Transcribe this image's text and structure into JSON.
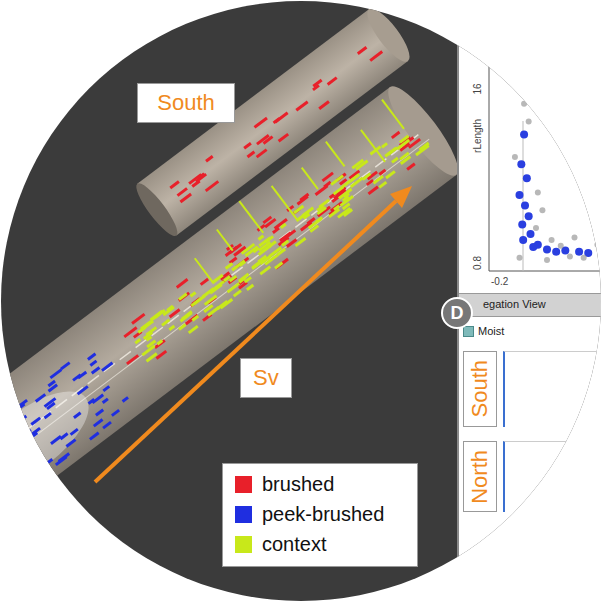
{
  "view3d": {
    "tunnel_label": "South",
    "axis_label": "Sv"
  },
  "legend": [
    {
      "label": "brushed",
      "color": "#e8202a"
    },
    {
      "label": "peek-brushed",
      "color": "#1f2ee0"
    },
    {
      "label": "context",
      "color": "#c8e81a"
    }
  ],
  "badge": "D",
  "scatter": {
    "y_label": "rLength",
    "y_ticks": [
      "16",
      "0.8"
    ],
    "x_ticks": [
      "-0.2"
    ],
    "points": [
      {
        "x": 0.15,
        "y": 11.9,
        "selected": true
      },
      {
        "x": 0.12,
        "y": 9.4,
        "selected": true
      },
      {
        "x": 0.18,
        "y": 8.2,
        "selected": true
      },
      {
        "x": 0.1,
        "y": 6.8,
        "selected": true
      },
      {
        "x": 0.16,
        "y": 5.9,
        "selected": true
      },
      {
        "x": 0.2,
        "y": 5.0,
        "selected": true
      },
      {
        "x": 0.13,
        "y": 4.3,
        "selected": true
      },
      {
        "x": 0.22,
        "y": 3.5,
        "selected": true
      },
      {
        "x": 0.3,
        "y": 2.6,
        "selected": true
      },
      {
        "x": 0.4,
        "y": 2.2,
        "selected": true
      },
      {
        "x": 0.5,
        "y": 2.0,
        "selected": true
      },
      {
        "x": 0.6,
        "y": 2.1,
        "selected": true
      },
      {
        "x": 0.75,
        "y": 2.0,
        "selected": true
      },
      {
        "x": 0.85,
        "y": 1.9,
        "selected": true
      },
      {
        "x": 0.14,
        "y": 3.0,
        "selected": true
      },
      {
        "x": 0.25,
        "y": 2.4,
        "selected": true
      },
      {
        "x": 0.15,
        "y": 14.5,
        "selected": false
      },
      {
        "x": 0.2,
        "y": 13.0,
        "selected": false
      },
      {
        "x": 0.05,
        "y": 10.0,
        "selected": false
      },
      {
        "x": 0.3,
        "y": 7.0,
        "selected": false
      },
      {
        "x": 0.35,
        "y": 5.5,
        "selected": false
      },
      {
        "x": 0.28,
        "y": 4.0,
        "selected": false
      },
      {
        "x": 0.45,
        "y": 3.0,
        "selected": false
      },
      {
        "x": 0.55,
        "y": 2.5,
        "selected": false
      },
      {
        "x": 0.65,
        "y": 1.6,
        "selected": false
      },
      {
        "x": 0.8,
        "y": 1.5,
        "selected": false
      },
      {
        "x": 0.95,
        "y": 2.6,
        "selected": false
      },
      {
        "x": 0.1,
        "y": 1.5,
        "selected": false
      },
      {
        "x": 0.4,
        "y": 1.3,
        "selected": false
      },
      {
        "x": 0.7,
        "y": 3.2,
        "selected": false
      }
    ]
  },
  "aggregation_view": {
    "title": "egation View",
    "checkbox": {
      "label": "Moist",
      "checked": true
    },
    "groups": [
      "South",
      "North"
    ]
  }
}
